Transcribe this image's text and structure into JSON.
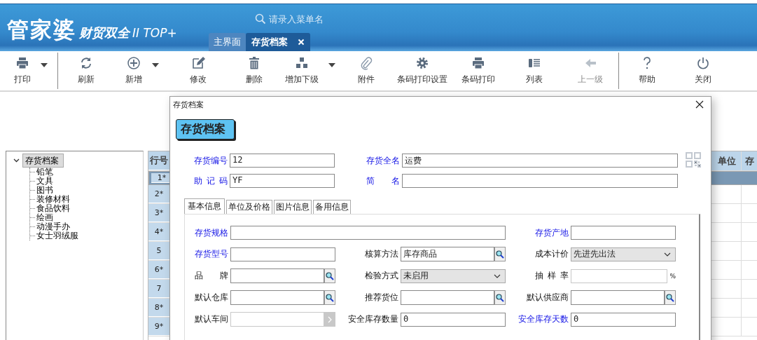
{
  "header": {
    "logo": "管家婆",
    "product": "财贸双全",
    "edition": "II TOP+",
    "search": {
      "placeholder": "请录入菜单名"
    },
    "tabs": [
      {
        "label": "主界面",
        "selected": false,
        "closable": false
      },
      {
        "label": "存货档案",
        "selected": true,
        "closable": true
      }
    ]
  },
  "toolbar": [
    {
      "items": [
        {
          "label": "打印",
          "dropdown": true,
          "disabled": false
        }
      ]
    },
    {
      "items": [
        {
          "label": "刷新",
          "dropdown": false,
          "disabled": false
        },
        {
          "label": "新增",
          "dropdown": true,
          "disabled": false
        },
        {
          "label": "修改",
          "dropdown": false,
          "disabled": false
        },
        {
          "label": "删除",
          "dropdown": false,
          "disabled": false
        },
        {
          "label": "增加下级",
          "dropdown": true,
          "disabled": false
        },
        {
          "label": "附件",
          "dropdown": false,
          "disabled": false
        },
        {
          "label": "条码打印设置",
          "dropdown": false,
          "disabled": false
        },
        {
          "label": "条码打印",
          "dropdown": false,
          "disabled": false
        },
        {
          "label": "列表",
          "dropdown": false,
          "disabled": false
        },
        {
          "label": "上一级",
          "dropdown": false,
          "disabled": true
        }
      ]
    },
    {
      "items": [
        {
          "label": "帮助",
          "dropdown": false,
          "disabled": false
        },
        {
          "label": "关闭",
          "dropdown": false,
          "disabled": false
        }
      ]
    }
  ],
  "tree": {
    "label": "存货档案",
    "expanded": true,
    "selected": true,
    "children": [
      {
        "label": "铅笔"
      },
      {
        "label": "文具"
      },
      {
        "label": "图书"
      },
      {
        "label": "装修材料"
      },
      {
        "label": "食品饮料"
      },
      {
        "label": "绘画"
      },
      {
        "label": "动漫手办"
      },
      {
        "label": "女士羽绒服"
      }
    ]
  },
  "table": {
    "columns": [
      "行号",
      "单位",
      "存"
    ],
    "rows": [
      {
        "number": "1*",
        "selected": true
      },
      {
        "number": "2*",
        "selected": false
      },
      {
        "number": "3*",
        "selected": false
      },
      {
        "number": "4*",
        "selected": false
      },
      {
        "number": "5",
        "selected": false
      },
      {
        "number": "6*",
        "selected": false
      },
      {
        "number": "7",
        "selected": false
      },
      {
        "number": "8*",
        "selected": false
      },
      {
        "number": "9*",
        "selected": false
      }
    ]
  },
  "dialog": {
    "title": "存货档案",
    "heading": "存货档案",
    "header_fields": [
      {
        "label": "存货编号",
        "value": "12",
        "emphasized": true
      },
      {
        "label": "存货全名",
        "value": "运费",
        "emphasized": true
      },
      {
        "label": "助 记 码",
        "value": "YF",
        "emphasized": true
      },
      {
        "label": "简 名",
        "emphasized": true
      }
    ],
    "tabs": [
      {
        "label": "基本信息",
        "selected": true
      },
      {
        "label": "单位及价格",
        "selected": false
      },
      {
        "label": "图片信息",
        "selected": false
      },
      {
        "label": "备用信息",
        "selected": false
      }
    ],
    "rows": [
      [
        {
          "label": "存货规格",
          "kind": "wide",
          "emphasized": true
        },
        "",
        {
          "label": "存货产地",
          "kind": "text",
          "emphasized": true
        }
      ],
      [
        {
          "label": "存货型号",
          "kind": "text",
          "emphasized": true
        },
        {
          "label": "核算方法",
          "kind": "lookup",
          "value": "库存商品",
          "emphasized": false
        },
        {
          "label": "成本计价",
          "kind": "select",
          "value": "先进先出法",
          "emphasized": false
        }
      ],
      [
        {
          "label": "品 牌",
          "kind": "lookup",
          "emphasized": false
        },
        {
          "label": "检验方式",
          "kind": "select",
          "value": "未启用",
          "emphasized": false
        },
        {
          "label": "抽 样 率",
          "kind": "text",
          "emphasized": false,
          "suffix": "%"
        }
      ],
      [
        {
          "label": "默认仓库",
          "kind": "lookup",
          "emphasized": false
        },
        {
          "label": "推荐货位",
          "kind": "lookup",
          "emphasized": false
        },
        {
          "label": "默认供应商",
          "kind": "lookup",
          "emphasized": false
        }
      ],
      [
        {
          "label": "默认车间",
          "kind": "disabled-lookup",
          "emphasized": false
        },
        {
          "label": "安全库存数量",
          "kind": "text",
          "value": "0",
          "emphasized": false
        },
        {
          "label": "安全库存天数",
          "kind": "text",
          "value": "0",
          "emphasized": true
        }
      ]
    ]
  }
}
